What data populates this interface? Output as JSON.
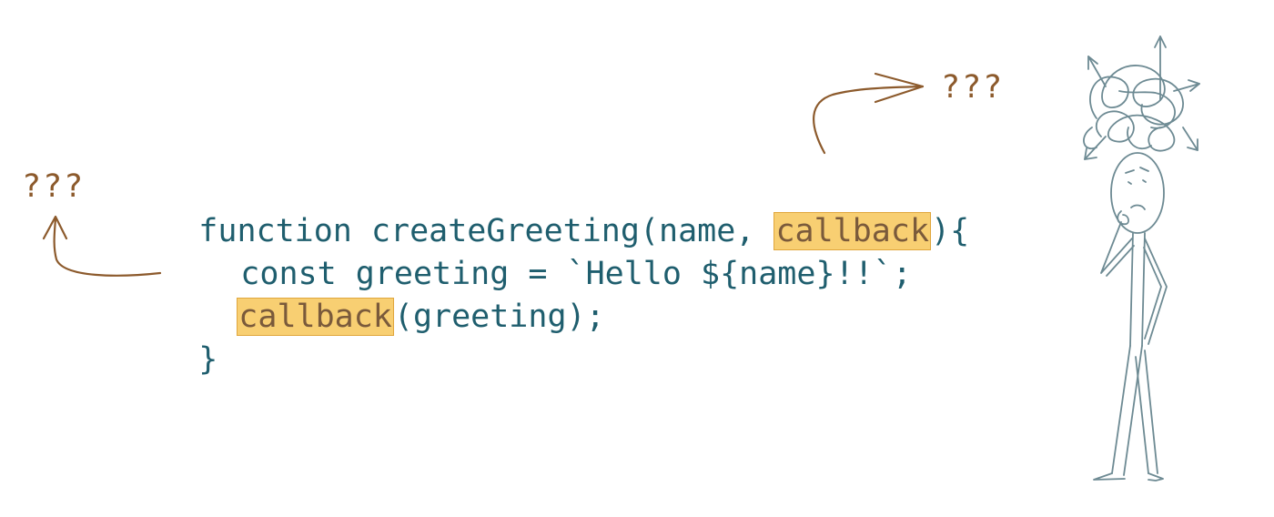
{
  "code": {
    "line1": {
      "before": "function createGreeting(name, ",
      "highlight": "callback",
      "after": "){"
    },
    "line2": "const greeting = `Hello ${name}!!`;",
    "line3": {
      "highlight": "callback",
      "after": "(greeting);"
    },
    "line4": "}"
  },
  "annotations": {
    "left_question": "???",
    "right_question": "???"
  },
  "icons": {
    "figure": "confused-stick-figure-icon",
    "tangle": "tangled-thoughts-icon"
  },
  "colors": {
    "code_text": "#1f5e6e",
    "highlight_fill": "#f8cf72",
    "highlight_border": "#e0a63c",
    "arrow": "#8c5a2c",
    "figure": "#6d8a93"
  }
}
